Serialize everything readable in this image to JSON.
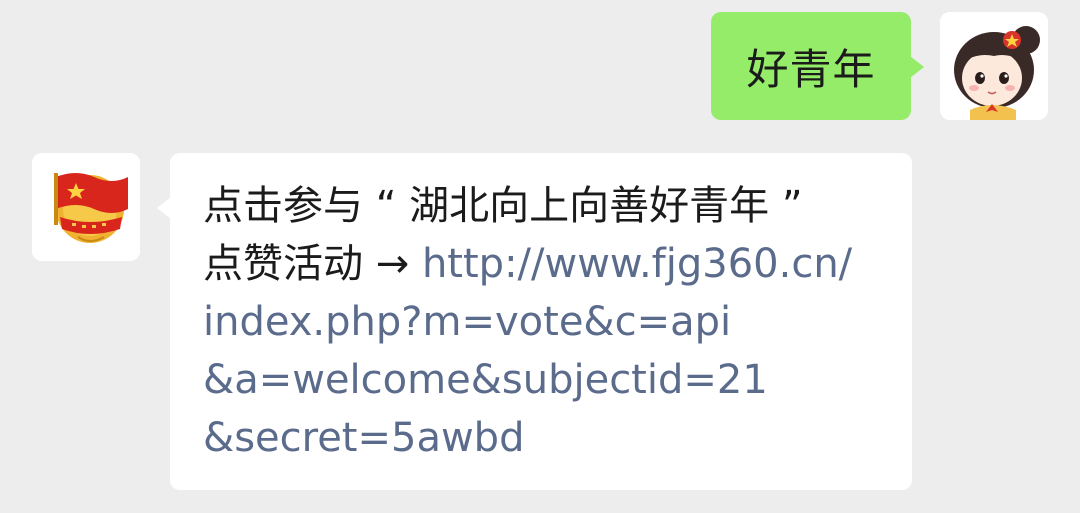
{
  "chat": {
    "outgoing": {
      "text": "好青年"
    },
    "incoming": {
      "line1": "点击参与 “ 湖北向上向善好青年 ”",
      "line2_prefix": "点赞活动 → ",
      "link_part1": "http://www.fjg360.cn/",
      "link_part2": "index.php?m=vote&c=api",
      "link_part3": "&a=welcome&subjectid=21",
      "link_part4": "&secret=5awbd"
    }
  },
  "colors": {
    "background": "#ededed",
    "outgoing_bubble": "#95ec69",
    "incoming_bubble": "#ffffff",
    "link": "#5b6b8c"
  },
  "icons": {
    "user_avatar": "cartoon-girl-avatar-icon",
    "bot_avatar": "youth-league-emblem-icon"
  }
}
